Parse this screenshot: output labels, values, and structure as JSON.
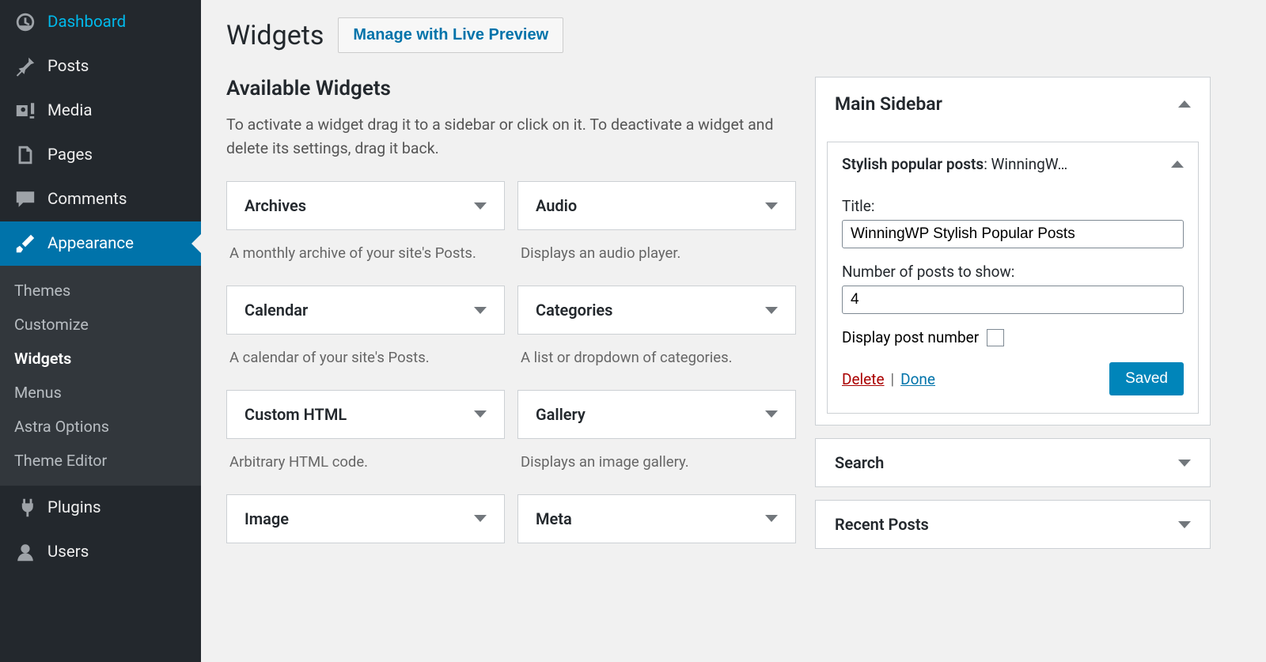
{
  "nav": {
    "items": [
      {
        "label": "Dashboard",
        "icon": "dashboard"
      },
      {
        "label": "Posts",
        "icon": "pin"
      },
      {
        "label": "Media",
        "icon": "media"
      },
      {
        "label": "Pages",
        "icon": "pages"
      },
      {
        "label": "Comments",
        "icon": "comments"
      },
      {
        "label": "Appearance",
        "icon": "brush",
        "active": true
      },
      {
        "label": "Plugins",
        "icon": "plug"
      },
      {
        "label": "Users",
        "icon": "users"
      }
    ],
    "submenu": [
      {
        "label": "Themes"
      },
      {
        "label": "Customize"
      },
      {
        "label": "Widgets",
        "current": true
      },
      {
        "label": "Menus"
      },
      {
        "label": "Astra Options"
      },
      {
        "label": "Theme Editor"
      }
    ]
  },
  "header": {
    "title": "Widgets",
    "preview_btn": "Manage with Live Preview"
  },
  "available": {
    "title": "Available Widgets",
    "desc": "To activate a widget drag it to a sidebar or click on it. To deactivate a widget and delete its settings, drag it back.",
    "widgets": [
      {
        "name": "Archives",
        "desc": "A monthly archive of your site's Posts."
      },
      {
        "name": "Audio",
        "desc": "Displays an audio player."
      },
      {
        "name": "Calendar",
        "desc": "A calendar of your site's Posts."
      },
      {
        "name": "Categories",
        "desc": "A list or dropdown of categories."
      },
      {
        "name": "Custom HTML",
        "desc": "Arbitrary HTML code."
      },
      {
        "name": "Gallery",
        "desc": "Displays an image gallery."
      },
      {
        "name": "Image",
        "desc": ""
      },
      {
        "name": "Meta",
        "desc": ""
      }
    ]
  },
  "area": {
    "title": "Main Sidebar",
    "widget": {
      "header_prefix": "Stylish popular posts",
      "header_suffix": ": WinningW…",
      "title_label": "Title:",
      "title_value": "WinningWP Stylish Popular Posts",
      "num_label": "Number of posts to show:",
      "num_value": "4",
      "display_label": "Display post number",
      "display_checked": false,
      "delete": "Delete",
      "done": "Done",
      "saved": "Saved"
    },
    "collapsed": [
      {
        "label": "Search"
      },
      {
        "label": "Recent Posts"
      }
    ]
  }
}
